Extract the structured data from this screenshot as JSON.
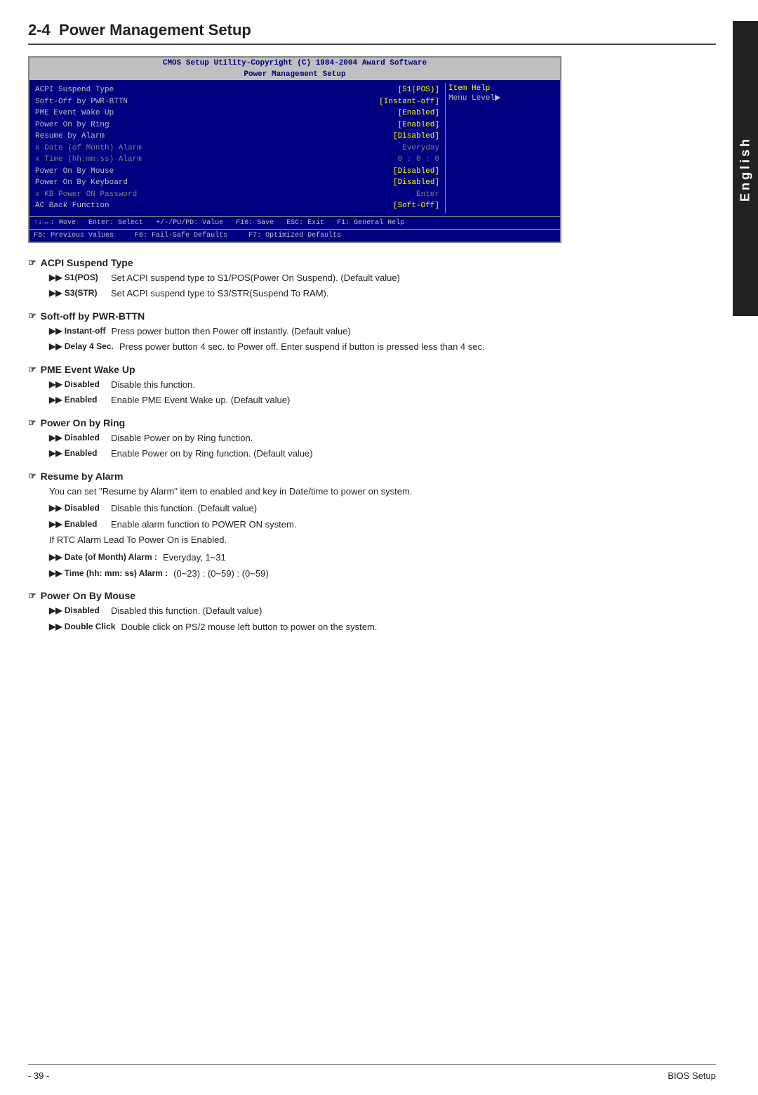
{
  "page": {
    "chapter": "2-4",
    "title": "Power Management Setup",
    "english_label": "English"
  },
  "bios": {
    "header1": "CMOS Setup Utility-Copyright (C) 1984-2004 Award Software",
    "header2": "Power Management Setup",
    "rows": [
      {
        "label": "ACPI Suspend Type",
        "value": "[S1(POS)]",
        "prefix": ""
      },
      {
        "label": "Soft-Off by PWR-BTTN",
        "value": "[Instant-off]",
        "prefix": ""
      },
      {
        "label": "PME Event Wake Up",
        "value": "[Enabled]",
        "prefix": ""
      },
      {
        "label": "Power On by Ring",
        "value": "[Enabled]",
        "prefix": ""
      },
      {
        "label": "Resume by Alarm",
        "value": "[Disabled]",
        "prefix": ""
      },
      {
        "label": "Date (of Month) Alarm",
        "value": "Everyday",
        "prefix": "x",
        "dimmed": true
      },
      {
        "label": "Time (hh:mm:ss) Alarm",
        "value": "0 : 0 : 0",
        "prefix": "x",
        "dimmed": true
      },
      {
        "label": "Power On By Mouse",
        "value": "[Disabled]",
        "prefix": ""
      },
      {
        "label": "Power On By Keyboard",
        "value": "[Disabled]",
        "prefix": ""
      },
      {
        "label": "KB Power ON Password",
        "value": "Enter",
        "prefix": "x",
        "dimmed": true
      },
      {
        "label": "AC Back Function",
        "value": "[Soft-Off]",
        "prefix": ""
      }
    ],
    "item_help_title": "Item Help",
    "item_help_text": "Menu Level▶",
    "footer": {
      "nav1": "↑↓→←: Move",
      "nav2": "Enter: Select",
      "nav3": "+/-/PU/PD: Value",
      "nav4": "F10: Save",
      "nav5": "ESC: Exit",
      "nav6": "F1: General Help",
      "nav7": "F5: Previous Values",
      "nav8": "F6: Fail-Safe Defaults",
      "nav9": "F7: Optimized Defaults"
    }
  },
  "sections": [
    {
      "id": "acpi-suspend-type",
      "title": "ACPI Suspend Type",
      "bullets": [
        {
          "term": "▶▶ S1(POS)",
          "desc": "Set ACPI suspend type to S1/POS(Power On Suspend). (Default value)"
        },
        {
          "term": "▶▶ S3(STR)",
          "desc": "Set ACPI suspend type to S3/STR(Suspend To RAM)."
        }
      ],
      "note": ""
    },
    {
      "id": "soft-off-pwr-bttn",
      "title": "Soft-off by PWR-BTTN",
      "bullets": [
        {
          "term": "▶▶ Instant-off",
          "desc": "Press power button then Power off instantly. (Default value)"
        },
        {
          "term": "▶▶ Delay 4 Sec.",
          "desc": "Press power button 4 sec. to Power off. Enter suspend if button is pressed less than 4 sec."
        }
      ],
      "note": ""
    },
    {
      "id": "pme-event-wake-up",
      "title": "PME Event Wake Up",
      "bullets": [
        {
          "term": "▶▶ Disabled",
          "desc": "Disable this function."
        },
        {
          "term": "▶▶ Enabled",
          "desc": "Enable PME Event Wake up. (Default value)"
        }
      ],
      "note": ""
    },
    {
      "id": "power-on-by-ring",
      "title": "Power On by Ring",
      "bullets": [
        {
          "term": "▶▶ Disabled",
          "desc": "Disable Power on by Ring function."
        },
        {
          "term": "▶▶ Enabled",
          "desc": "Enable Power on by Ring function. (Default value)"
        }
      ],
      "note": ""
    },
    {
      "id": "resume-by-alarm",
      "title": "Resume by Alarm",
      "note": "You can set \"Resume by Alarm\" item to enabled and key in Date/time to power on system.",
      "bullets": [
        {
          "term": "▶▶ Disabled",
          "desc": "Disable this function. (Default value)"
        },
        {
          "term": "▶▶ Enabled",
          "desc": "Enable alarm function to POWER ON system."
        }
      ],
      "subnote": "If RTC Alarm Lead To Power On is Enabled.",
      "subbullets": [
        {
          "term": "▶▶ Date (of Month) Alarm :",
          "desc": "Everyday, 1~31"
        },
        {
          "term": "▶▶ Time (hh: mm: ss) Alarm :",
          "desc": "(0~23) : (0~59) : (0~59)"
        }
      ]
    },
    {
      "id": "power-on-by-mouse",
      "title": "Power On By Mouse",
      "bullets": [
        {
          "term": "▶▶ Disabled",
          "desc": "Disabled this function. (Default value)"
        },
        {
          "term": "▶▶ Double Click",
          "desc": "Double click on PS/2 mouse left button to power on the system."
        }
      ],
      "note": ""
    }
  ],
  "footer": {
    "page_number": "- 39 -",
    "right_text": "BIOS Setup"
  }
}
